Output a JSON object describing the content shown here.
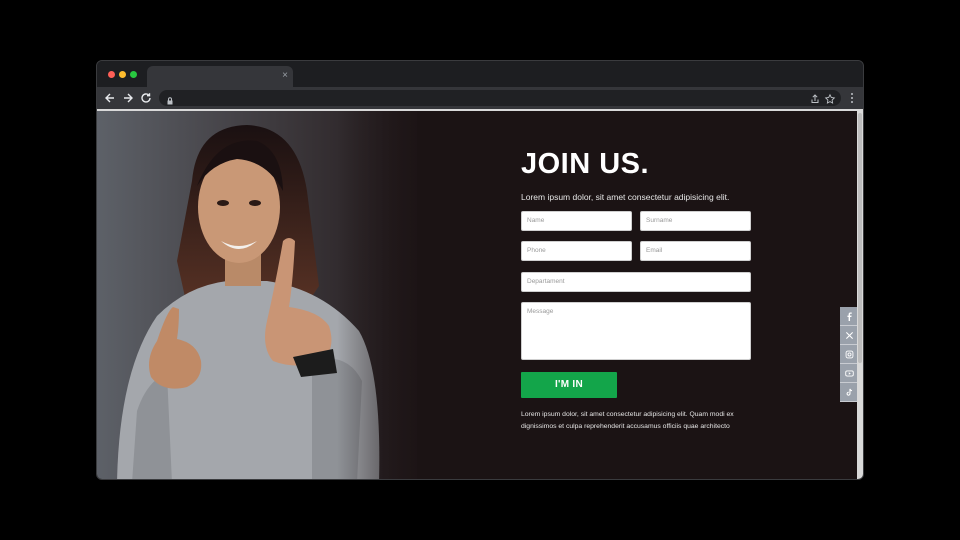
{
  "browser": {
    "tab_close_glyph": "×",
    "url": ""
  },
  "page": {
    "title": "JOIN US.",
    "subtitle": "Lorem ipsum dolor, sit amet consectetur adipisicing elit.",
    "fields": {
      "name": "Name",
      "surname": "Surname",
      "phone": "Phone",
      "email": "Email",
      "department": "Departament",
      "message": "Message"
    },
    "submit_label": "I'M IN",
    "footnote": "Lorem ipsum dolor, sit amet consectetur adipisicing elit. Quam modi ex dignissimos et culpa reprehenderit accusamus officiis quae architecto"
  },
  "social": [
    "facebook-icon",
    "x-icon",
    "instagram-icon",
    "youtube-icon",
    "tiktok-icon"
  ],
  "colors": {
    "background": "#1b1314",
    "accent_button": "#13a54a",
    "social_button": "#9aa1ab"
  }
}
